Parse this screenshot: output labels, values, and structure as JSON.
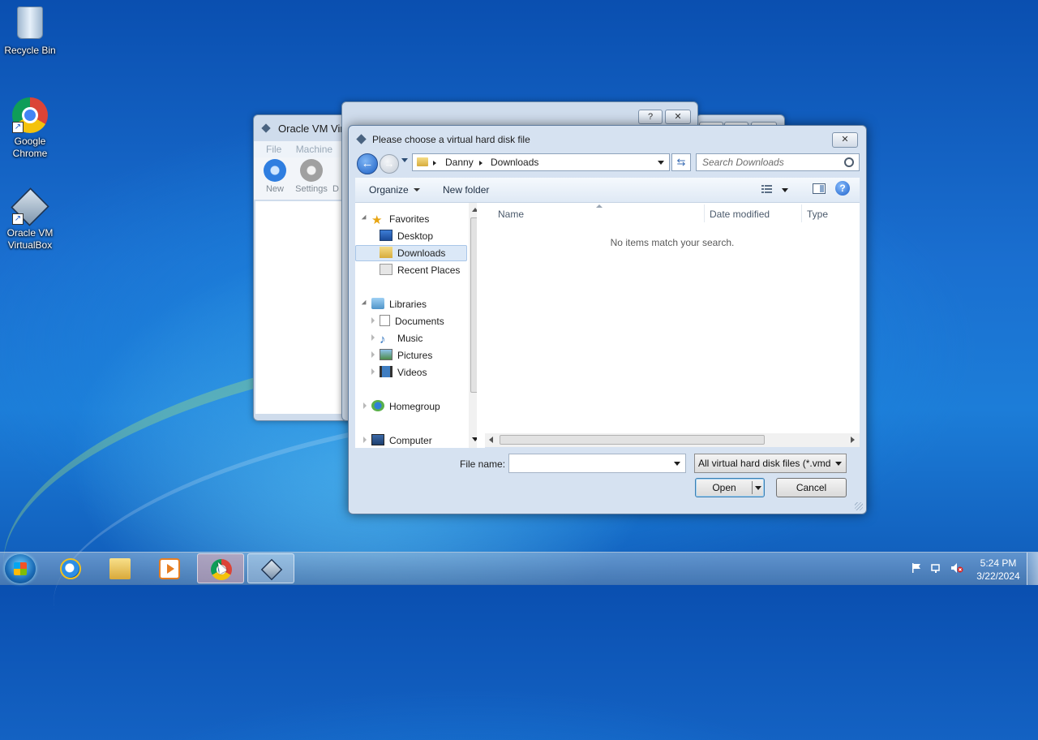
{
  "desktop": {
    "icons": [
      {
        "label": "Recycle Bin",
        "icon": "recycle-bin-icon"
      },
      {
        "label": "Google Chrome",
        "icon": "chrome-icon"
      },
      {
        "label": "Oracle VM VirtualBox",
        "icon": "virtualbox-icon"
      }
    ]
  },
  "vbox_manager": {
    "title": "Oracle VM Virtu",
    "menu": [
      "File",
      "Machine"
    ],
    "toolbar": [
      {
        "label": "New",
        "icon": "new-vm-icon"
      },
      {
        "label": "Settings",
        "icon": "gear-icon"
      },
      {
        "label": "D"
      }
    ]
  },
  "mid_dialog": {
    "help_label": "?",
    "close_label": "✕"
  },
  "dialog": {
    "title": "Please choose a virtual hard disk file",
    "close_label": "✕",
    "breadcrumb": [
      "Danny",
      "Downloads"
    ],
    "search_placeholder": "Search Downloads",
    "organize_label": "Organize",
    "new_folder_label": "New folder",
    "help_label": "?",
    "nav": {
      "favorites": "Favorites",
      "favorites_items": [
        "Desktop",
        "Downloads",
        "Recent Places"
      ],
      "libraries": "Libraries",
      "libraries_items": [
        "Documents",
        "Music",
        "Pictures",
        "Videos"
      ],
      "homegroup": "Homegroup",
      "computer": "Computer"
    },
    "columns": [
      "Name",
      "Date modified",
      "Type"
    ],
    "empty_message": "No items match your search.",
    "file_name_label": "File name:",
    "file_name_value": "",
    "file_type_value": "All virtual hard disk files (*.vmd",
    "open_label": "Open",
    "cancel_label": "Cancel"
  },
  "taskbar": {
    "items": [
      "start-button",
      "internet-explorer-icon",
      "windows-explorer-icon",
      "media-player-icon",
      "chrome-icon",
      "virtualbox-icon"
    ],
    "active_item": "chrome-icon",
    "clock_time": "5:24 PM",
    "clock_date": "3/22/2024"
  }
}
